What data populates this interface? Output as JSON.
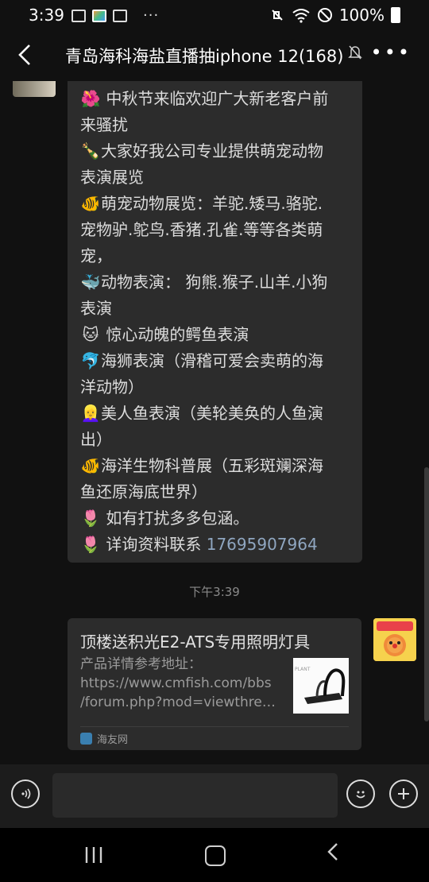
{
  "status_bar": {
    "time": "3:39",
    "more": "···",
    "battery_pct": "100%"
  },
  "header": {
    "title": "青岛海科海盐直播抽iphone 12(168)",
    "back_icon": "chevron-left-icon",
    "mute_icon": "bell-off-icon",
    "more_label": "•••"
  },
  "message1": {
    "lines": [
      {
        "emoji": "🌺",
        "text": " 中秋节来临欢迎广大新老客户前"
      },
      {
        "emoji": "",
        "text": "来骚扰"
      },
      {
        "emoji": "🍾",
        "text": "大家好我公司专业提供萌宠动物"
      },
      {
        "emoji": "",
        "text": "表演展览"
      },
      {
        "emoji": "🐠",
        "text": "萌宠动物展览：羊驼.矮马.骆驼."
      },
      {
        "emoji": "",
        "text": "宠物驴.鸵鸟.香猪.孔雀.等等各类萌"
      },
      {
        "emoji": "",
        "text": "宠，"
      },
      {
        "emoji": "🐳",
        "text": "动物表演： 狗熊.猴子.山羊.小狗"
      },
      {
        "emoji": "",
        "text": "表演"
      },
      {
        "emoji": "🐱",
        "text": " 惊心动魄的鳄鱼表演"
      },
      {
        "emoji": "🐬",
        "text": "海狮表演（滑稽可爱会卖萌的海"
      },
      {
        "emoji": "",
        "text": "洋动物）"
      },
      {
        "emoji": "👱‍♀️",
        "text": "美人鱼表演（美轮美奂的人鱼演"
      },
      {
        "emoji": "",
        "text": "出）"
      },
      {
        "emoji": "🐠",
        "text": "海洋生物科普展（五彩斑斓深海"
      },
      {
        "emoji": "",
        "text": "鱼还原海底世界）"
      },
      {
        "emoji": "🌷",
        "text": " 如有打扰多多包涵。"
      },
      {
        "emoji": "🌷",
        "text": " 详询资料联系 "
      }
    ],
    "phone": "17695907964"
  },
  "timestamp": "下午3:39",
  "link_card": {
    "title": "顶楼送积光E2-ATS专用照明灯具",
    "desc_lines": [
      "产品详情参考地址：",
      "https://www.cmfish.com/bbs",
      "/forum.php?mod=viewthread&tid"
    ],
    "source": "海友网",
    "source_icon": "site-logo-icon",
    "thumb_icon": "lamp-product-icon"
  },
  "input_bar": {
    "voice_icon": "voice-icon",
    "emoji_icon": "emoji-icon",
    "plus_icon": "plus-icon",
    "placeholder": ""
  },
  "nav_bar": {
    "recent_icon": "recent-apps-icon",
    "home_icon": "home-icon",
    "back_icon": "back-icon"
  }
}
